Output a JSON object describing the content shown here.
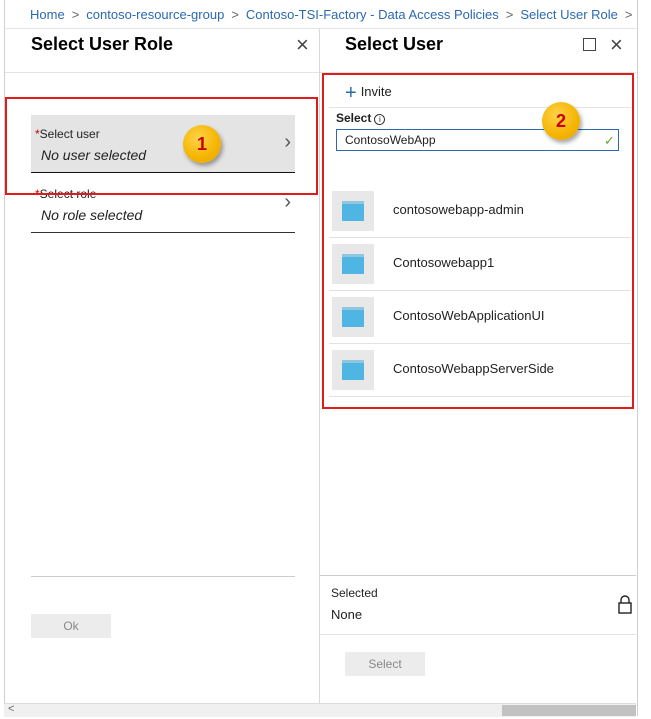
{
  "breadcrumb": {
    "items": [
      "Home",
      "contoso-resource-group",
      "Contoso-TSI-Factory - Data Access Policies",
      "Select User Role",
      "S"
    ]
  },
  "left_pane": {
    "title": "Select User Role",
    "fields": [
      {
        "label": "Select user",
        "required_mark": "*",
        "value": "No user selected",
        "selected": true
      },
      {
        "label": "Select role",
        "required_mark": "*",
        "value": "No role selected",
        "selected": false
      }
    ],
    "ok_label": "Ok"
  },
  "right_pane": {
    "title": "Select User",
    "invite_label": "Invite",
    "select_label": "Select",
    "search_value": "ContosoWebApp",
    "results": [
      {
        "name": "contosowebapp-admin"
      },
      {
        "name": "Contosowebapp1"
      },
      {
        "name": "ContosoWebApplicationUI"
      },
      {
        "name": "ContosoWebappServerSide"
      }
    ],
    "selected_label": "Selected",
    "selected_value": "None",
    "select_button_label": "Select"
  },
  "annotations": {
    "badge_1": "1",
    "badge_2": "2",
    "highlight_color": "#e01b1b",
    "badge_color": "#f4b400"
  },
  "icons": {
    "close": "close-icon",
    "maximize": "maximize-icon",
    "chevron": "chevron-right-icon",
    "plus": "plus-icon",
    "info": "info-icon",
    "check": "checkmark-icon",
    "lock": "lock-icon",
    "app": "application-icon"
  }
}
